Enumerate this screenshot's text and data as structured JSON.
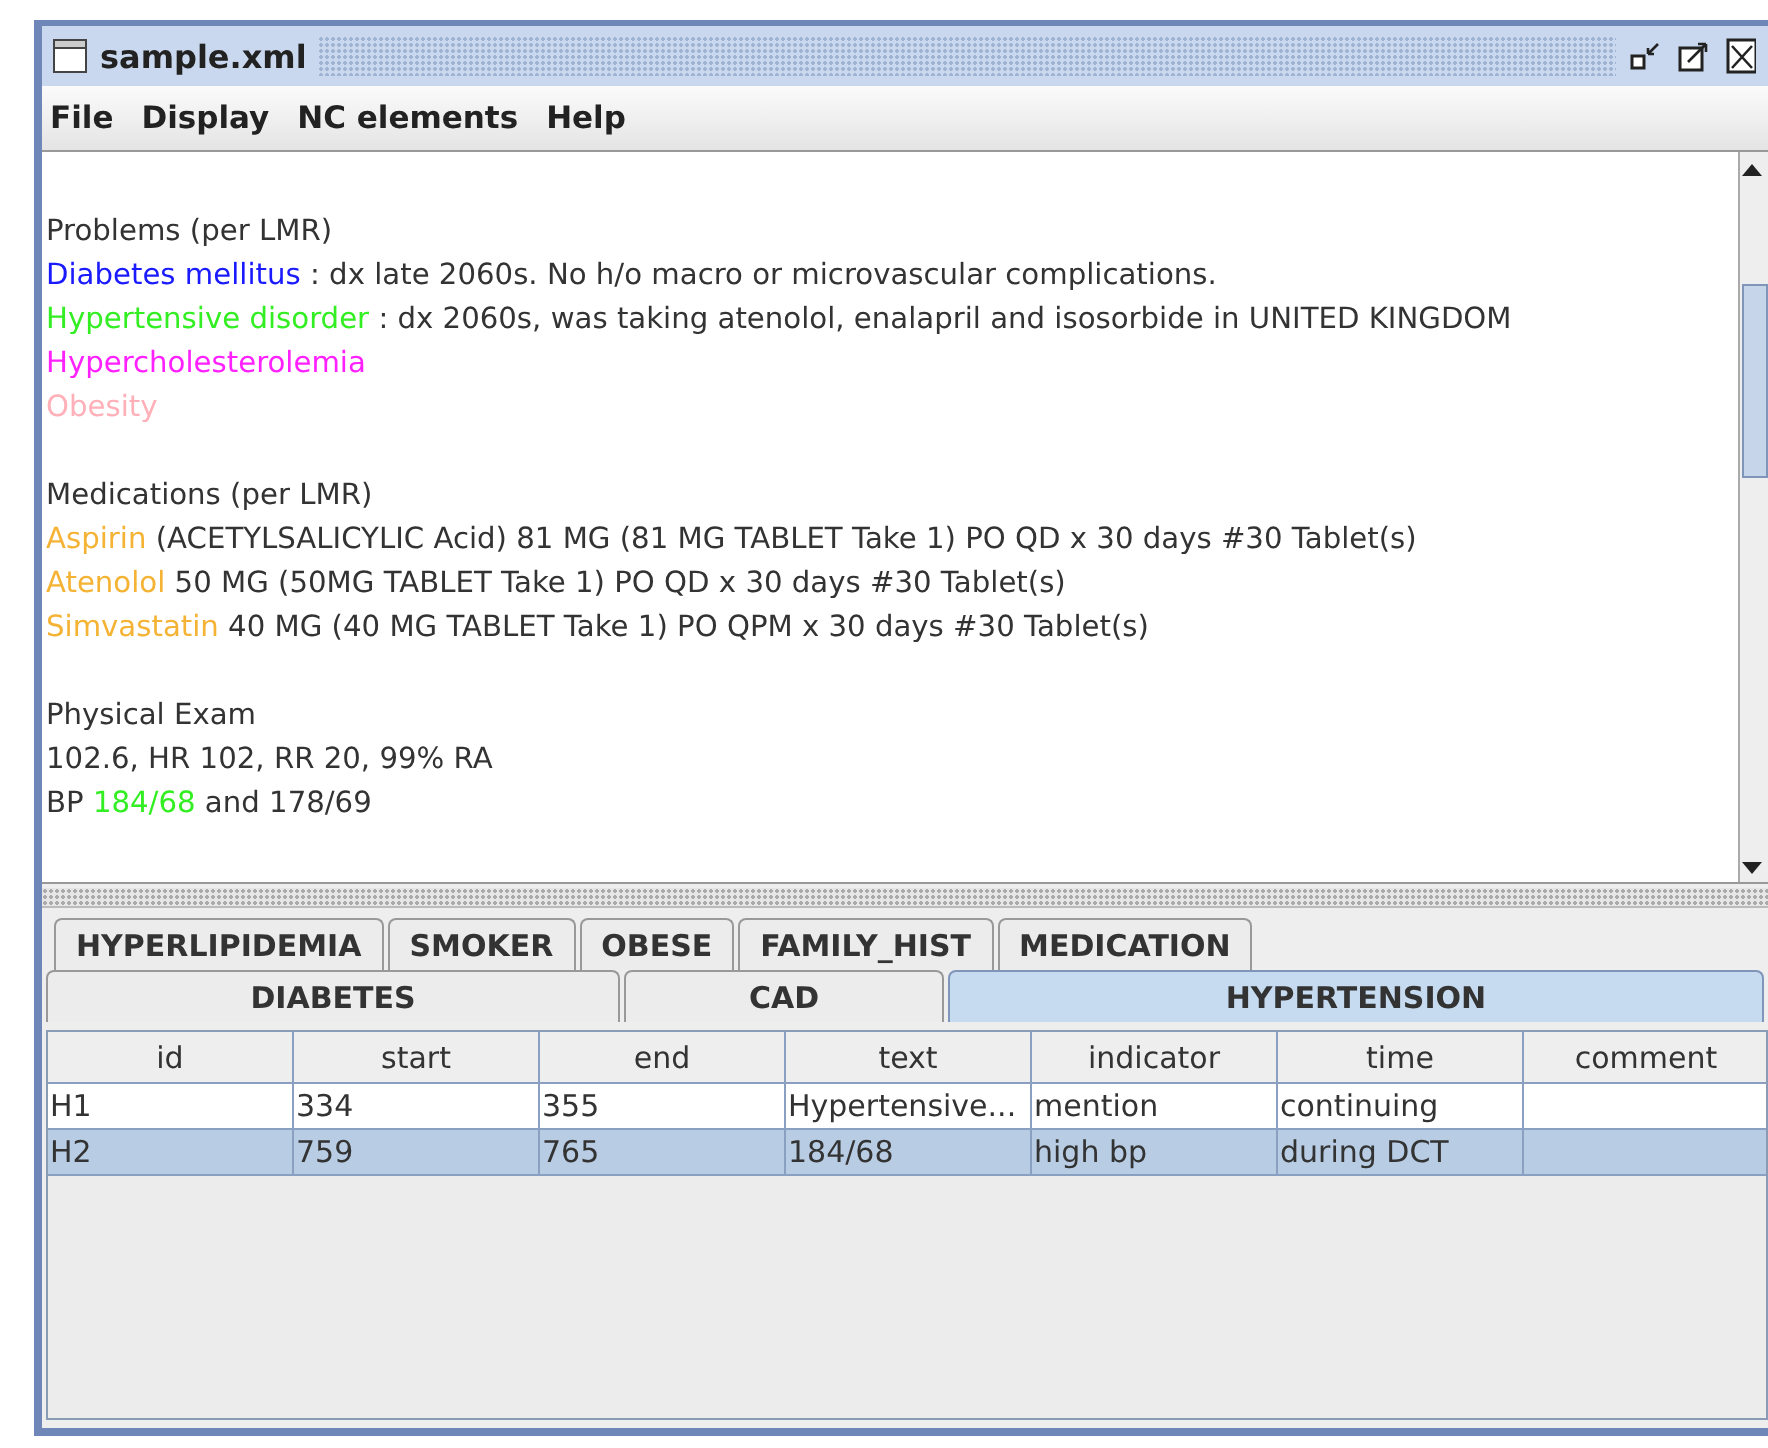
{
  "window": {
    "title": "sample.xml"
  },
  "menu": [
    "File",
    "Display",
    "NC elements",
    "Help"
  ],
  "document": {
    "sections": [
      {
        "heading": "Problems (per LMR)",
        "lines": [
          [
            {
              "text": "Diabetes mellitus",
              "color": "#1a1aff"
            },
            {
              "text": " : dx late 2060s. No h/o macro or microvascular complications."
            }
          ],
          [
            {
              "text": "Hypertensive disorder",
              "color": "#33ee22"
            },
            {
              "text": " : dx 2060s, was taking atenolol, enalapril and isosorbide in UNITED KINGDOM"
            }
          ],
          [
            {
              "text": "Hypercholesterolemia",
              "color": "#ff22ff"
            }
          ],
          [
            {
              "text": "Obesity",
              "color": "#ffb0b8"
            }
          ]
        ]
      },
      {
        "heading": "Medications (per LMR)",
        "lines": [
          [
            {
              "text": "Aspirin",
              "color": "#f5b335"
            },
            {
              "text": " (ACETYLSALICYLIC Acid) 81 MG (81 MG TABLET Take 1) PO QD x 30 days #30 Tablet(s)"
            }
          ],
          [
            {
              "text": "Atenolol",
              "color": "#f5b335"
            },
            {
              "text": " 50 MG (50MG TABLET Take 1) PO QD x 30 days #30 Tablet(s)"
            }
          ],
          [
            {
              "text": "Simvastatin",
              "color": "#f5b335"
            },
            {
              "text": " 40 MG (40 MG TABLET Take 1) PO QPM x 30 days #30 Tablet(s)"
            }
          ]
        ]
      },
      {
        "heading": "Physical Exam",
        "lines": [
          [
            {
              "text": "102.6, HR 102, RR 20, 99% RA"
            }
          ],
          [
            {
              "text": "BP "
            },
            {
              "text": "184/68",
              "color": "#33ee22"
            },
            {
              "text": " and 178/69"
            }
          ]
        ]
      }
    ]
  },
  "tab_rows": [
    [
      {
        "label": "HYPERLIPIDEMIA",
        "selected": false
      },
      {
        "label": "SMOKER",
        "selected": false
      },
      {
        "label": "OBESE",
        "selected": false
      },
      {
        "label": "FAMILY_HIST",
        "selected": false
      },
      {
        "label": "MEDICATION",
        "selected": false
      }
    ],
    [
      {
        "label": "DIABETES",
        "selected": false
      },
      {
        "label": "CAD",
        "selected": false
      },
      {
        "label": "HYPERTENSION",
        "selected": true
      }
    ]
  ],
  "table": {
    "columns": [
      "id",
      "start",
      "end",
      "text",
      "indicator",
      "time",
      "comment"
    ],
    "rows": [
      {
        "cells": [
          "H1",
          "334",
          "355",
          "Hypertensive...",
          "mention",
          "continuing",
          ""
        ],
        "selected": false
      },
      {
        "cells": [
          "H2",
          "759",
          "765",
          "184/68",
          "high bp",
          "during DCT",
          ""
        ],
        "selected": true
      }
    ]
  }
}
